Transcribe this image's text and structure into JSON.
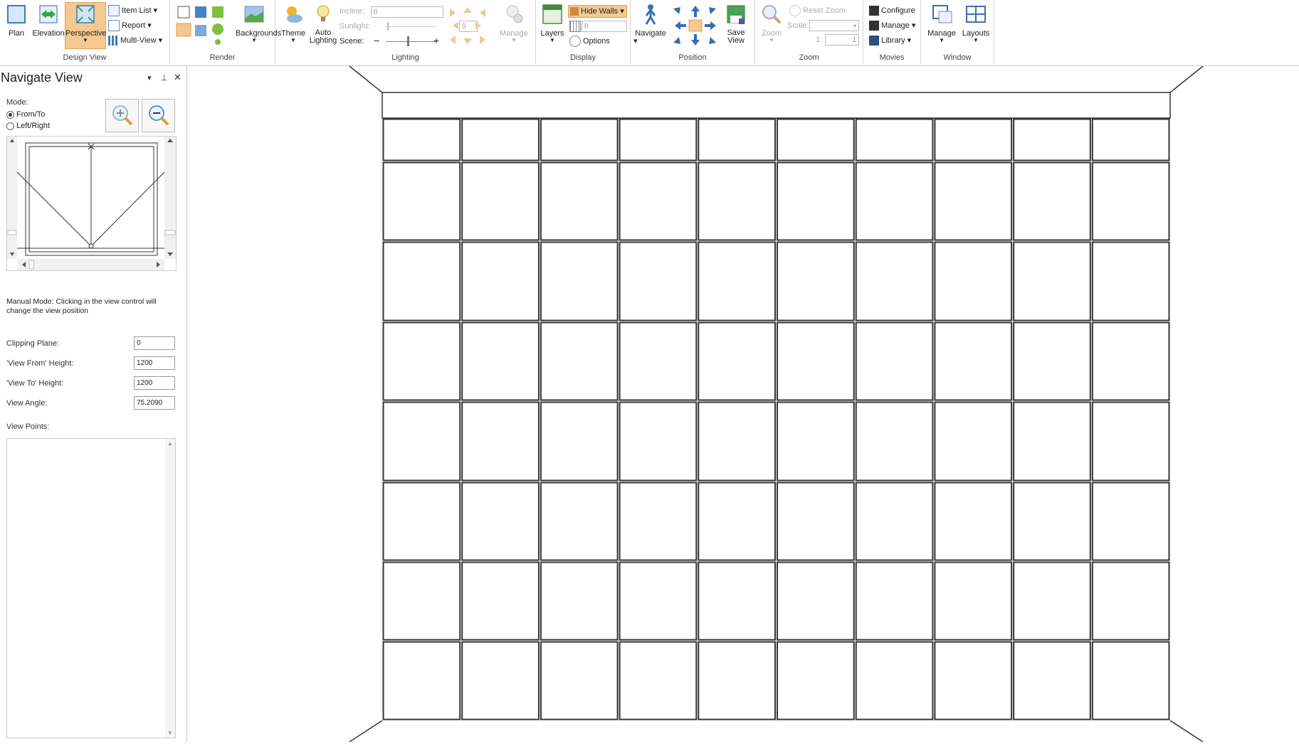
{
  "ribbon": {
    "design_view": {
      "label": "Design View",
      "plan": "Plan",
      "elevation": "Elevation",
      "perspective": "Perspective",
      "item_list": "Item List",
      "report": "Report",
      "multi_view": "Multi-View"
    },
    "render": {
      "label": "Render",
      "backgrounds": "Backgrounds"
    },
    "lighting": {
      "label": "Lighting",
      "theme": "Theme",
      "auto_lighting": "Auto Lighting",
      "incline_label": "Incline:",
      "incline_value": "0",
      "sunlight_label": "Sunlight:",
      "sunlight_value": "0",
      "scene_label": "Scene:",
      "manage": "Manage"
    },
    "display": {
      "label": "Display",
      "layers": "Layers",
      "hide_walls": "Hide Walls",
      "walls_value": "0",
      "options": "Options"
    },
    "position": {
      "label": "Position",
      "navigate": "Navigate",
      "save_view": "Save View"
    },
    "zoom": {
      "label": "Zoom",
      "zoom": "Zoom",
      "reset_zoom": "Reset Zoom",
      "scale_label": "Scale:",
      "ratio_prefix": "1:",
      "ratio_value": "1"
    },
    "movies": {
      "label": "Movies",
      "configure": "Configure",
      "manage": "Manage",
      "library": "Library"
    },
    "window": {
      "label": "Window",
      "manage": "Manage",
      "layouts": "Layouts"
    }
  },
  "panel": {
    "title": "Navigate View",
    "mode_label": "Mode:",
    "mode_options": [
      "From/To",
      "Left/Right"
    ],
    "mode_selected": "From/To",
    "manual_mode_note": "Manual Mode: Clicking in the view control will change the view position",
    "clipping_plane_label": "Clipping Plane:",
    "clipping_plane_value": "0",
    "view_from_height_label": "'View From' Height:",
    "view_from_height_value": "1200",
    "view_to_height_label": "'View To' Height:",
    "view_to_height_value": "1200",
    "view_angle_label": "View Angle:",
    "view_angle_value": "75.2090",
    "view_points_label": "View Points:"
  },
  "colors": {
    "accent": "#f4c890",
    "accent_border": "#e0a050",
    "grid_line": "#333333"
  }
}
